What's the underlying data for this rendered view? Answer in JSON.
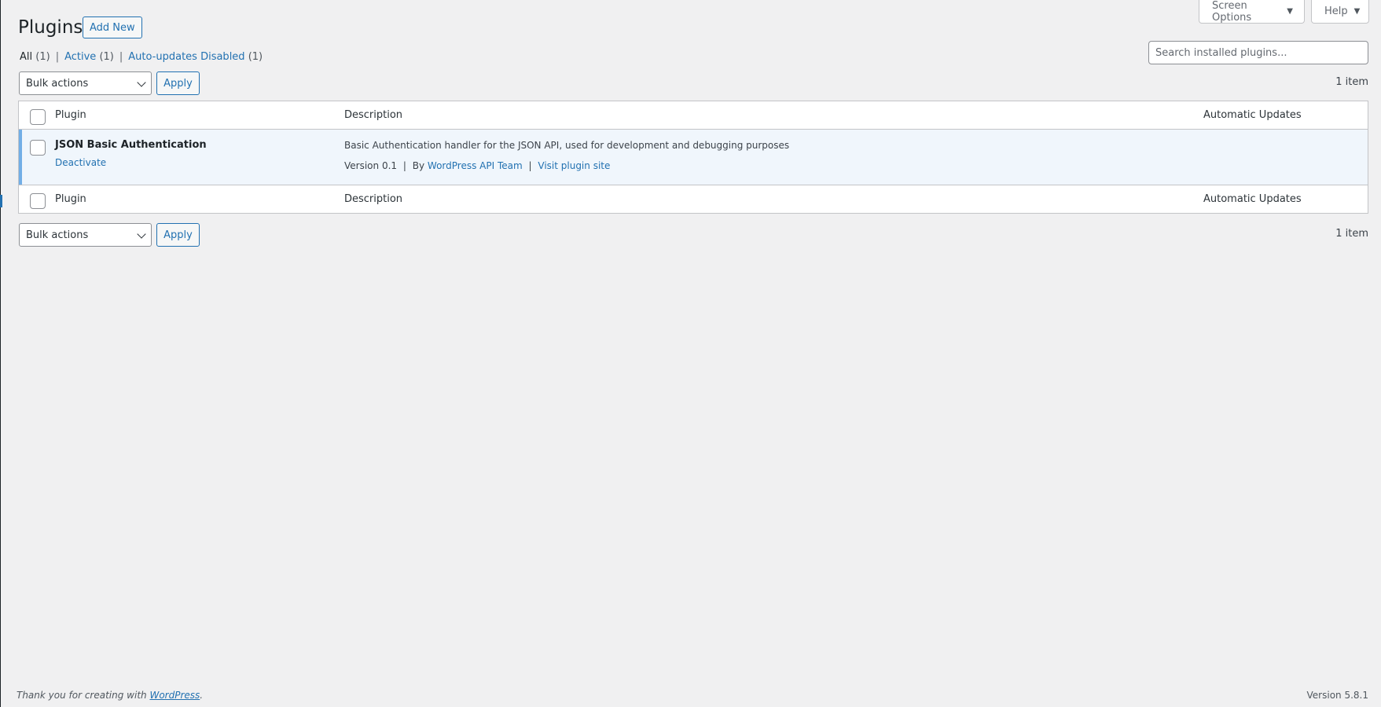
{
  "screen_meta": {
    "screen_options_label": "Screen Options",
    "help_label": "Help"
  },
  "header": {
    "title": "Plugins",
    "add_new_label": "Add New"
  },
  "filters": {
    "all_label": "All",
    "all_count": "(1)",
    "active_label": "Active",
    "active_count": "(1)",
    "auto_disabled_label": "Auto-updates Disabled",
    "auto_disabled_count": "(1)",
    "separator": "|"
  },
  "search": {
    "placeholder": "Search installed plugins..."
  },
  "tablenav": {
    "bulk_actions": "Bulk actions",
    "apply_label": "Apply",
    "item_count": "1 item"
  },
  "table": {
    "columns": {
      "plugin": "Plugin",
      "description": "Description",
      "auto_updates": "Automatic Updates"
    },
    "rows": [
      {
        "name": "JSON Basic Authentication",
        "action": "Deactivate",
        "description": "Basic Authentication handler for the JSON API, used for development and debugging purposes",
        "version": "Version 0.1",
        "by_prefix": "By",
        "author": "WordPress API Team",
        "site_link": "Visit plugin site",
        "bar": "|"
      }
    ]
  },
  "footer": {
    "thanks_prefix": "Thank you for creating with ",
    "wp_link": "WordPress",
    "thanks_suffix": ".",
    "version": "Version 5.8.1"
  },
  "colors": {
    "accent": "#2271b1",
    "active_row_bg": "#f0f6fc",
    "active_row_border": "#72aee6",
    "page_bg": "#f0f0f1"
  }
}
